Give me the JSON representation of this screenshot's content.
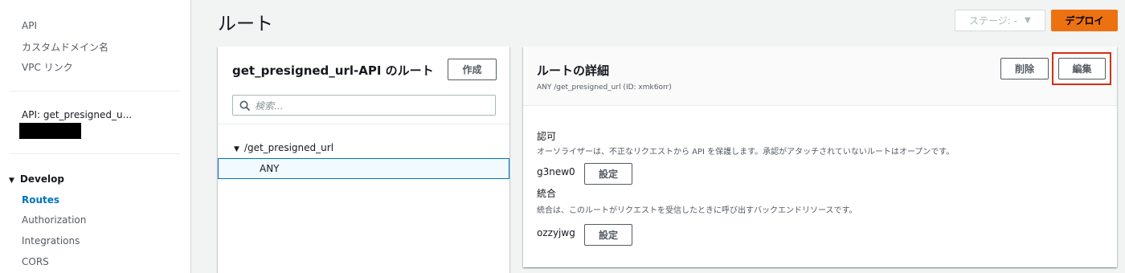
{
  "sidebar": {
    "top_items": [
      "API",
      "カスタムドメイン名",
      "VPC リンク"
    ],
    "api_name": "API: get_presigned_u...",
    "section": "Develop",
    "develop_items": [
      "Routes",
      "Authorization",
      "Integrations",
      "CORS"
    ]
  },
  "header": {
    "title": "ルート",
    "stage_label": "ステージ: -",
    "deploy_label": "デプロイ"
  },
  "routes_panel": {
    "title": "get_presigned_url-API のルート",
    "create_label": "作成",
    "search_placeholder": "検索...",
    "tree": {
      "path": "/get_presigned_url",
      "method": "ANY"
    }
  },
  "details_panel": {
    "title": "ルートの詳細",
    "subtitle": "ANY /get_presigned_url (ID: xmk6orr)",
    "delete_label": "削除",
    "edit_label": "編集",
    "authorization": {
      "label": "認可",
      "description": "オーソライザーは、不正なリクエストから API を保護します。承認がアタッチされていないルートはオープンです。",
      "value": "g3new0",
      "button": "設定"
    },
    "integration": {
      "label": "統合",
      "description": "統合は、このルートがリクエストを受信したときに呼び出すバックエンドリソースです。",
      "value": "ozzyjwg",
      "button": "設定"
    }
  },
  "colors": {
    "accent": "#0073bb",
    "deploy": "#ec7211",
    "highlight": "#d13212"
  }
}
